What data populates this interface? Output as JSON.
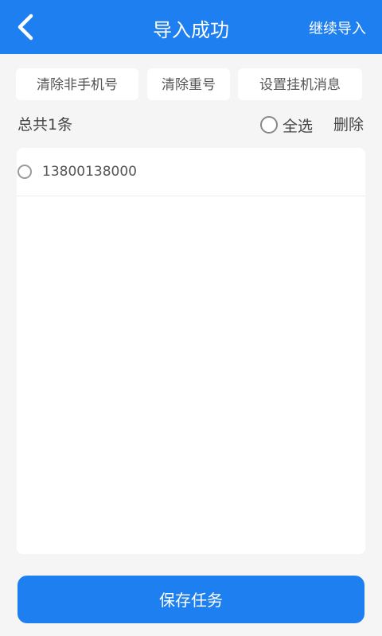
{
  "header": {
    "title": "导入成功",
    "right_action": "继续导入"
  },
  "actions": [
    {
      "label": "清除非手机号"
    },
    {
      "label": "清除重号"
    },
    {
      "label": "设置挂机消息"
    }
  ],
  "summary": {
    "total_label": "总共1条",
    "select_all_label": "全选",
    "delete_label": "删除"
  },
  "list": {
    "items": [
      {
        "phone": "13800138000",
        "selected": false
      }
    ]
  },
  "footer": {
    "save_label": "保存任务"
  },
  "colors": {
    "primary": "#1e7ff0",
    "background": "#f5f5f5"
  }
}
